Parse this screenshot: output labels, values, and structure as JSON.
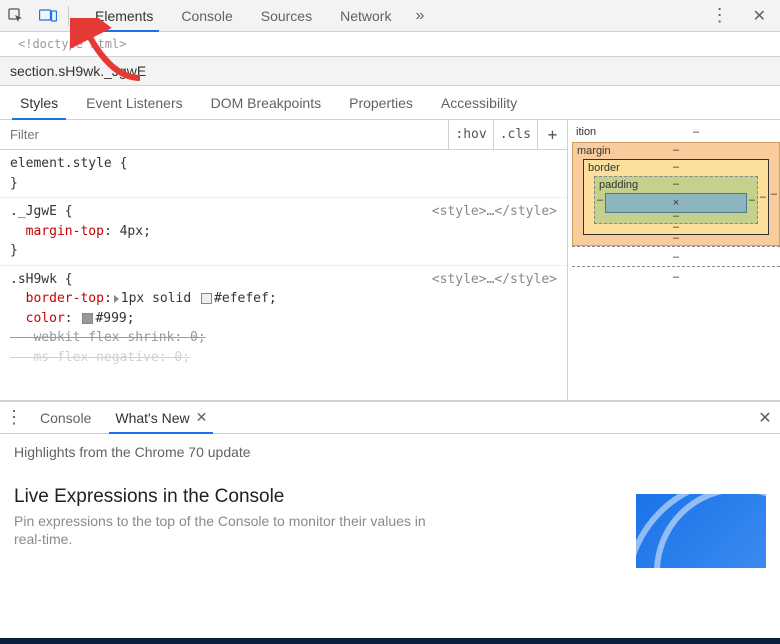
{
  "toolbar": {
    "tabs": [
      "Elements",
      "Console",
      "Sources",
      "Network"
    ],
    "active_index": 0
  },
  "dom_view": {
    "line": "<!doctype html>"
  },
  "breadcrumb": "section.sH9wk._JgwE",
  "subtabs": {
    "items": [
      "Styles",
      "Event Listeners",
      "DOM Breakpoints",
      "Properties",
      "Accessibility"
    ],
    "active_index": 0
  },
  "filter": {
    "placeholder": "Filter",
    "hov": ":hov",
    "cls": ".cls"
  },
  "rules": {
    "element_style": {
      "selector": "element.style",
      "open": "{",
      "close": "}"
    },
    "jgwe": {
      "selector": "._JgwE",
      "open": "{",
      "close": "}",
      "source": "<style>…</style>",
      "prop1_name": "margin-top",
      "prop1_value": "4px"
    },
    "sh9wk": {
      "selector": ".sH9wk",
      "open": "{",
      "source": "<style>…</style>",
      "border_top_name": "border-top",
      "border_top_value": "1px solid",
      "border_top_color": "#efefef",
      "color_name": "color",
      "color_value": "#999",
      "webkit_flex": "-webkit-flex-shrink: 0;",
      "ms_flex": "-ms-flex-negative: 0;"
    }
  },
  "box_model": {
    "position_label": "ition",
    "margin_label": "margin",
    "border_label": "border",
    "padding_label": "padding",
    "dash": "–",
    "content": "×"
  },
  "drawer": {
    "tabs": [
      "Console",
      "What's New"
    ],
    "active_index": 1,
    "subtitle": "Highlights from the Chrome 70 update",
    "card_title": "Live Expressions in the Console",
    "card_desc": "Pin expressions to the top of the Console to monitor their values in real-time."
  }
}
